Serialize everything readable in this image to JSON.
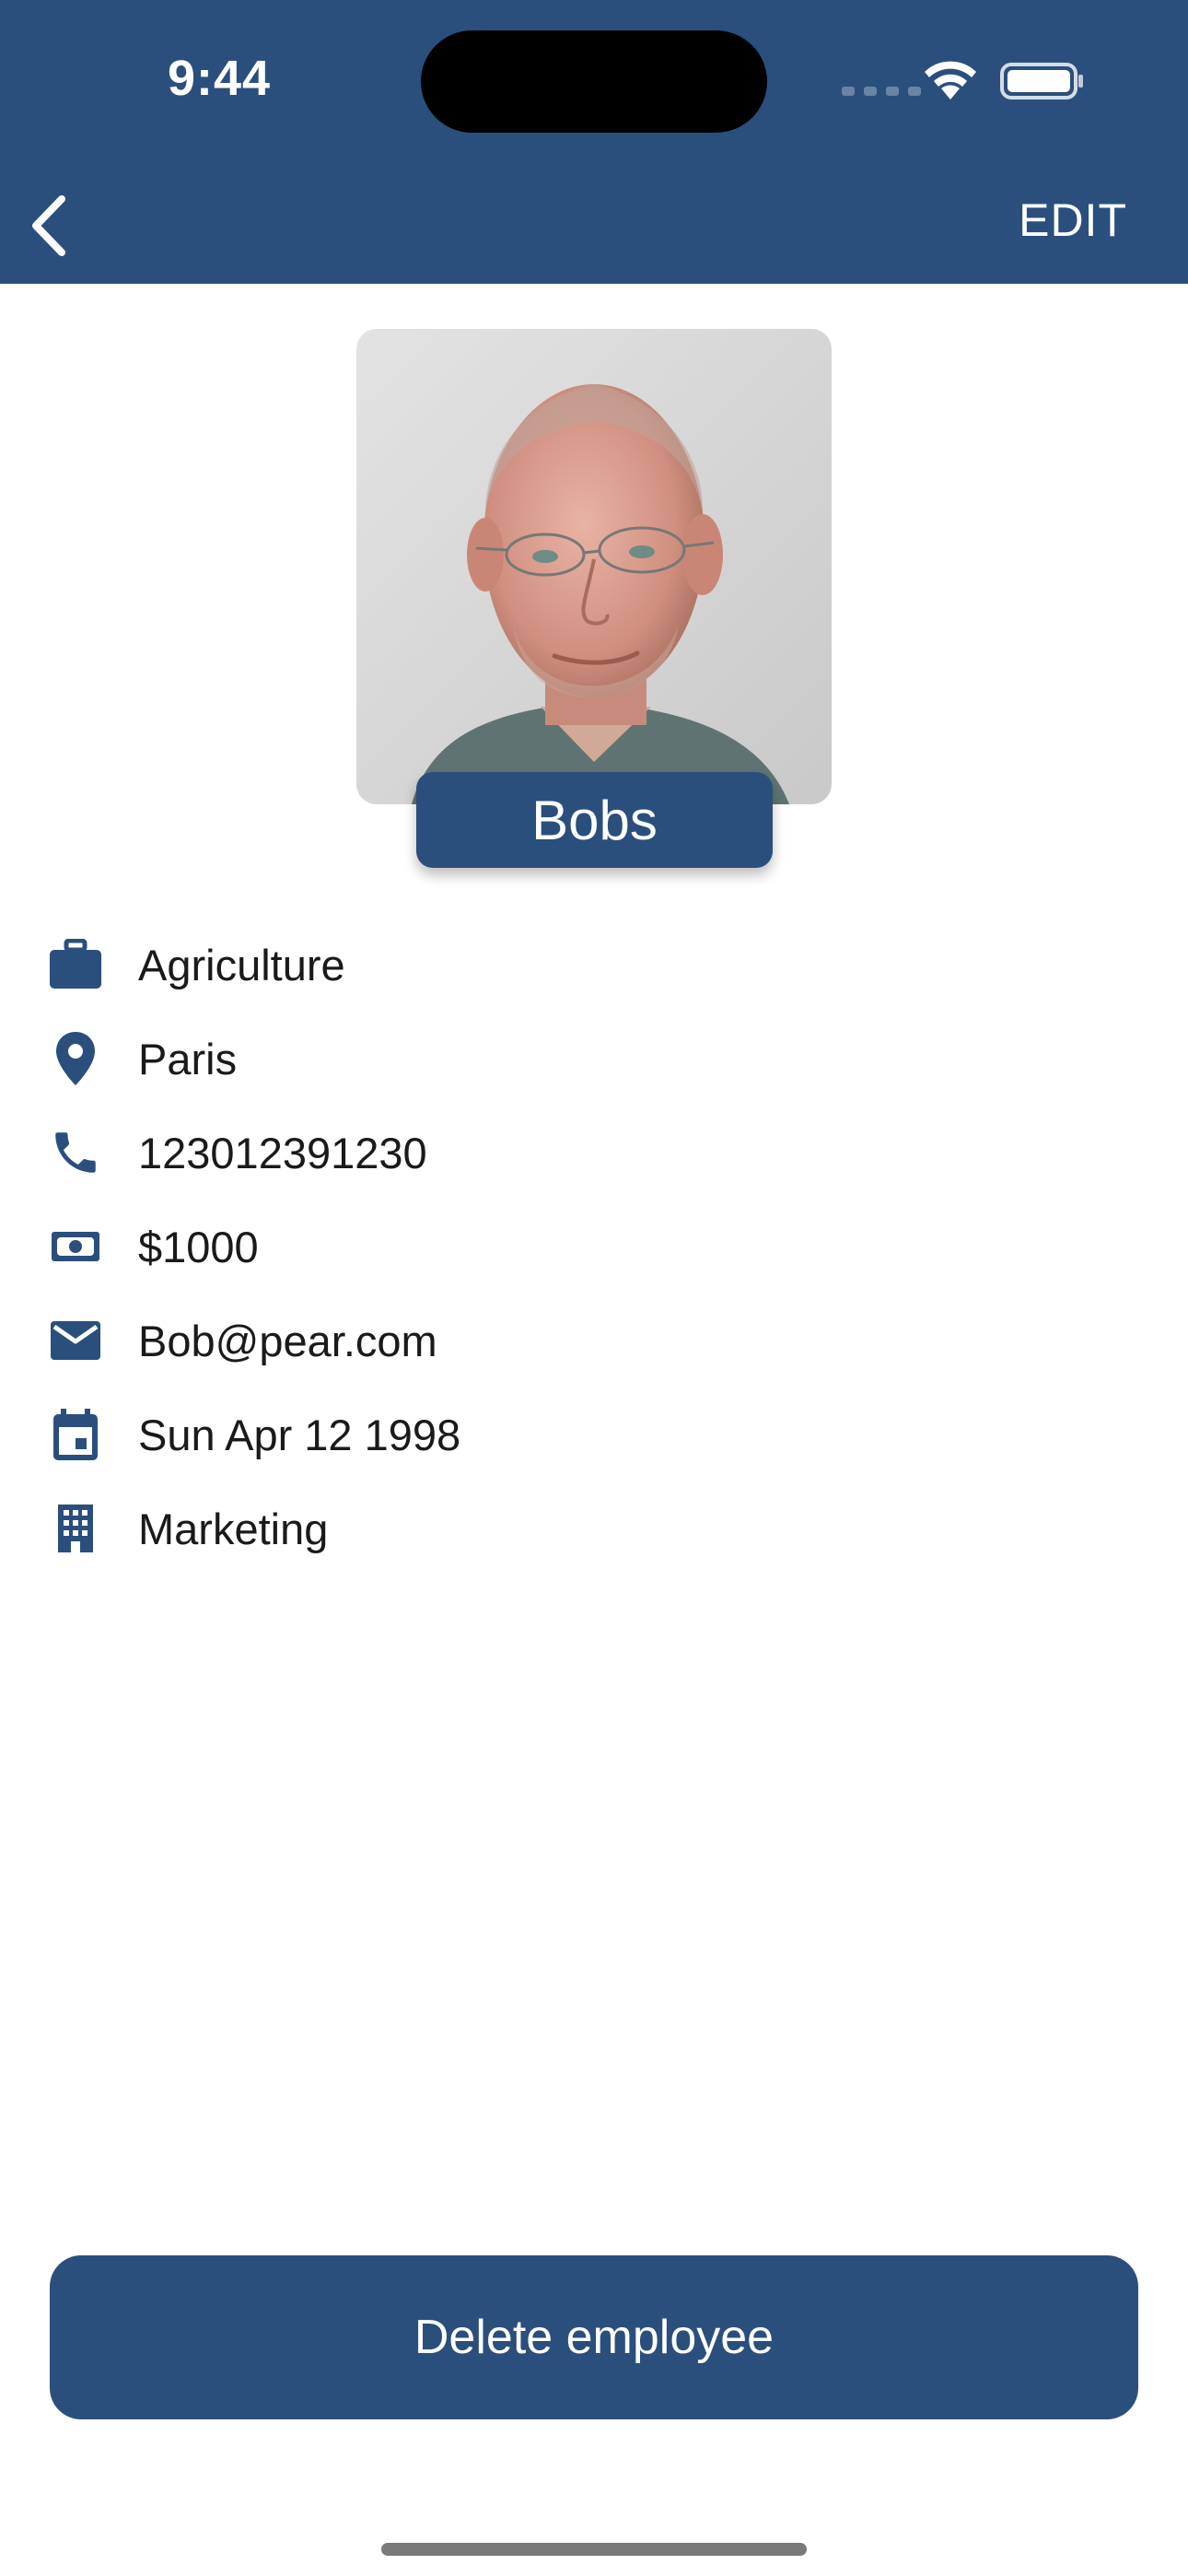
{
  "status_bar": {
    "time": "9:44",
    "icons": [
      "cellular-signal-icon",
      "wifi-icon",
      "battery-icon"
    ]
  },
  "nav": {
    "back_icon": "chevron-left-icon",
    "edit_label": "EDIT"
  },
  "profile": {
    "name": "Bobs"
  },
  "details": [
    {
      "icon": "briefcase-icon",
      "value": "Agriculture"
    },
    {
      "icon": "location-pin-icon",
      "value": "Paris"
    },
    {
      "icon": "phone-icon",
      "value": "123012391230"
    },
    {
      "icon": "money-icon",
      "value": "$1000"
    },
    {
      "icon": "email-icon",
      "value": "Bob@pear.com"
    },
    {
      "icon": "calendar-icon",
      "value": "Sun Apr 12 1998"
    },
    {
      "icon": "building-icon",
      "value": "Marketing"
    }
  ],
  "actions": {
    "delete_label": "Delete employee"
  },
  "colors": {
    "primary": "#2a4f7c",
    "background": "#ffffff",
    "text": "#1a1a1a"
  }
}
